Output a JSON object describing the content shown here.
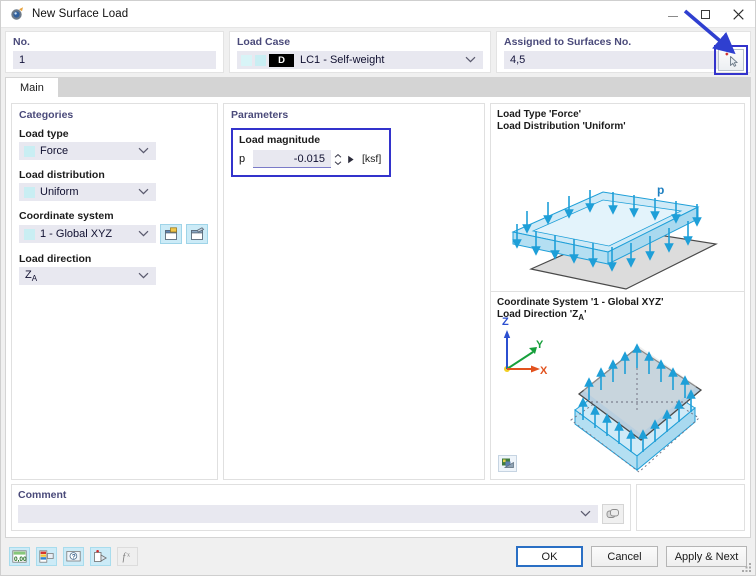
{
  "window": {
    "title": "New Surface Load",
    "icon": "app-icon",
    "minimize_label": "Minimize",
    "maximize_label": "Maximize",
    "close_label": "Close"
  },
  "top": {
    "no": {
      "label": "No.",
      "value": "1"
    },
    "load_case": {
      "label": "Load Case",
      "badge": "D",
      "value": "LC1 - Self-weight"
    },
    "assigned": {
      "label": "Assigned to Surfaces No.",
      "value": "4,5",
      "pick_button_name": "select-surfaces-button"
    }
  },
  "tabs": [
    {
      "label": "Main",
      "active": true
    }
  ],
  "categories": {
    "title": "Categories",
    "fields": [
      {
        "label": "Load type",
        "value": "Force"
      },
      {
        "label": "Load distribution",
        "value": "Uniform"
      },
      {
        "label": "Coordinate system",
        "value": "1 - Global XYZ"
      },
      {
        "label": "Load direction",
        "value": "Z",
        "sub": "A"
      }
    ],
    "new_cs_button": "new-coordinate-system-button",
    "edit_cs_button": "edit-coordinate-system-button"
  },
  "parameters": {
    "title": "Parameters",
    "load_magnitude": {
      "label": "Load magnitude",
      "symbol": "p",
      "value": "-0.015",
      "unit": "[ksf]"
    }
  },
  "preview": {
    "top": {
      "caption_line1": "Load Type 'Force'",
      "caption_line2": "Load Distribution 'Uniform'",
      "load_symbol": "p"
    },
    "bottom": {
      "caption_line1": "Coordinate System '1 - Global XYZ'",
      "caption_line2_pre": "Load Direction 'Z",
      "caption_line2_sub": "A",
      "caption_line2_post": "'",
      "axes": {
        "x": "X",
        "y": "Y",
        "z": "Z"
      },
      "corner_button": "preview-options-button"
    }
  },
  "comment": {
    "label": "Comment",
    "value": "",
    "placeholder": ""
  },
  "footer": {
    "tools": [
      {
        "name": "units-decimal-places-button",
        "enabled": true
      },
      {
        "name": "display-properties-button",
        "enabled": true
      },
      {
        "name": "help-button",
        "enabled": true
      },
      {
        "name": "model-info-button",
        "enabled": true
      },
      {
        "name": "formula-button",
        "enabled": false
      }
    ],
    "buttons": {
      "ok": "OK",
      "cancel": "Cancel",
      "apply_next": "Apply & Next"
    }
  },
  "colors": {
    "accent_blue": "#3333cc",
    "field_bg": "#e8e8f0",
    "group_label": "#4a4a7a",
    "arrow_blue": "#2f3fd0",
    "load_arrow": "#1e9fd8"
  }
}
